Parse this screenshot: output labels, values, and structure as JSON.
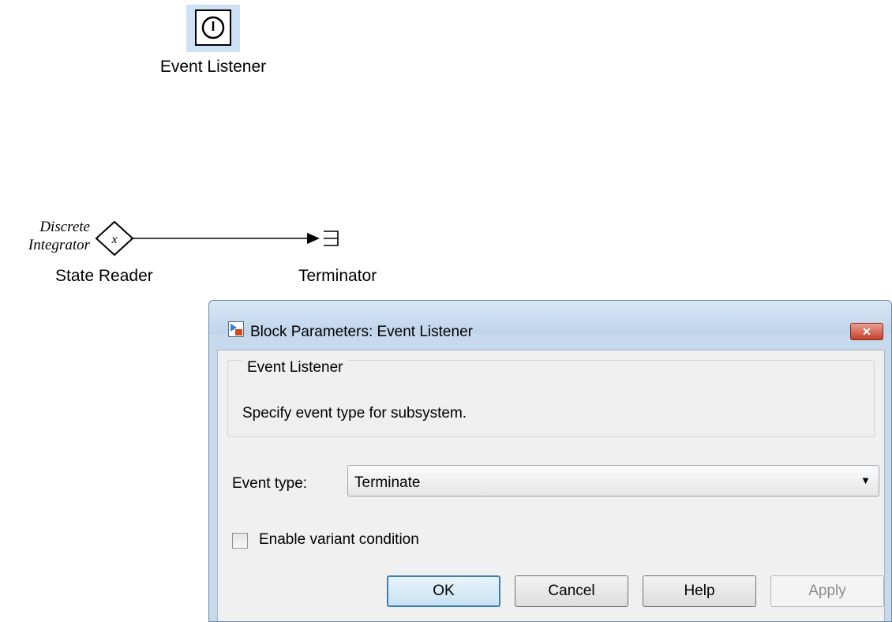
{
  "canvas": {
    "event_listener_label": "Event Listener",
    "state_reader": {
      "italic_line1": "Discrete",
      "italic_line2": "Integrator",
      "glyph": "x",
      "label": "State Reader"
    },
    "terminator_label": "Terminator"
  },
  "dialog": {
    "title": "Block Parameters: Event Listener",
    "close_glyph": "✕",
    "group_title": "Event Listener",
    "description": "Specify event type for subsystem.",
    "event_type_label": "Event type:",
    "event_type_value": "Terminate",
    "dropdown_arrow": "▼",
    "variant_checkbox_label": "Enable variant condition",
    "variant_checked": false,
    "buttons": {
      "ok": "OK",
      "cancel": "Cancel",
      "help": "Help",
      "apply": "Apply"
    }
  },
  "icons": [
    "power-icon",
    "block-parameters-icon",
    "close-icon",
    "chevron-down-icon"
  ]
}
